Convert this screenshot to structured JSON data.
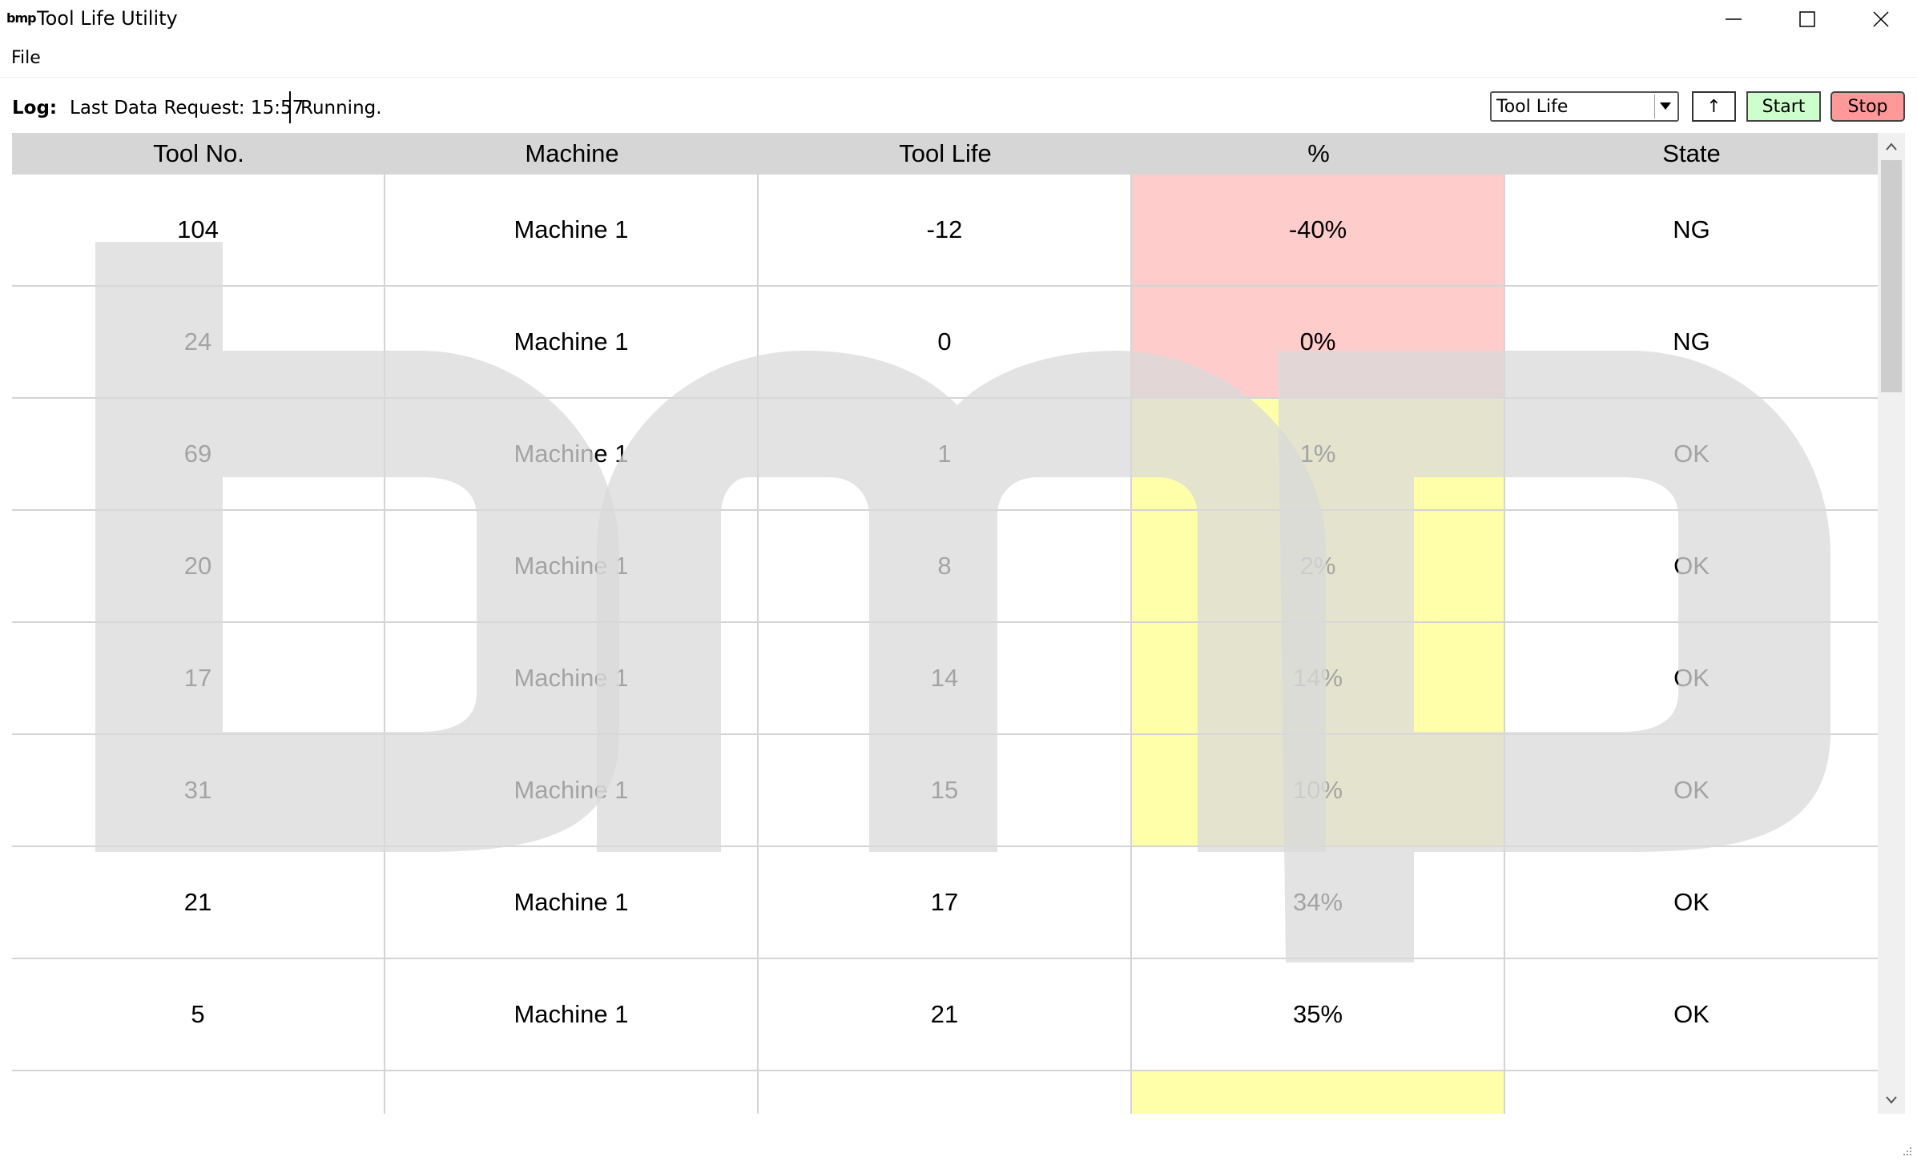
{
  "window": {
    "logo_text": "bmp",
    "title": "Tool Life Utility",
    "minimize_icon": "minimize-icon",
    "maximize_icon": "maximize-icon",
    "close_icon": "close-icon"
  },
  "menu": {
    "file_label": "File"
  },
  "log": {
    "label": "Log:",
    "last_request": "Last Data Request: 15:57",
    "status": "Running."
  },
  "toolbar": {
    "view_select_value": "Tool Life",
    "sort_button_label": "↑",
    "start_label": "Start",
    "stop_label": "Stop",
    "start_color": "#ccffcc",
    "stop_color": "#ff9999"
  },
  "table": {
    "columns": [
      "Tool No.",
      "Machine",
      "Tool Life",
      "%",
      "State"
    ],
    "rows": [
      {
        "tool": "104",
        "machine": "Machine 1",
        "life": "-12",
        "pct": "-40%",
        "state": "NG",
        "pct_color": "#ffcccc"
      },
      {
        "tool": "24",
        "machine": "Machine 1",
        "life": "0",
        "pct": "0%",
        "state": "NG",
        "pct_color": "#ffcccc"
      },
      {
        "tool": "69",
        "machine": "Machine 1",
        "life": "1",
        "pct": "1%",
        "state": "OK",
        "pct_color": "#ffffaa"
      },
      {
        "tool": "20",
        "machine": "Machine 1",
        "life": "8",
        "pct": "2%",
        "state": "OK",
        "pct_color": "#ffffaa"
      },
      {
        "tool": "17",
        "machine": "Machine 1",
        "life": "14",
        "pct": "14%",
        "state": "OK",
        "pct_color": "#ffffaa"
      },
      {
        "tool": "31",
        "machine": "Machine 1",
        "life": "15",
        "pct": "10%",
        "state": "OK",
        "pct_color": "#ffffaa"
      },
      {
        "tool": "21",
        "machine": "Machine 1",
        "life": "17",
        "pct": "34%",
        "state": "OK",
        "pct_color": "#ffffff"
      },
      {
        "tool": "5",
        "machine": "Machine 1",
        "life": "21",
        "pct": "35%",
        "state": "OK",
        "pct_color": "#ffffff"
      },
      {
        "tool": "",
        "machine": "",
        "life": "",
        "pct": "",
        "state": "",
        "pct_color": "#ffffaa"
      }
    ]
  },
  "watermark": {
    "text": "bmp",
    "color": "#e0e0e0"
  }
}
